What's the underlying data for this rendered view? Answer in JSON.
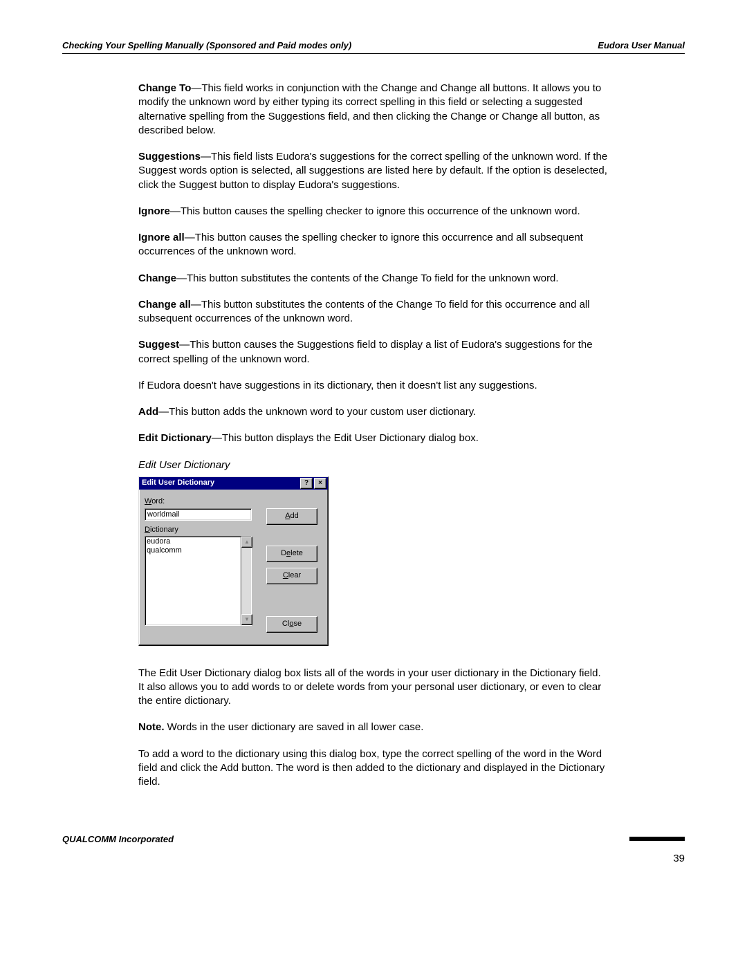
{
  "header": {
    "left": "Checking Your Spelling Manually (Sponsored and Paid modes only)",
    "right": "Eudora User Manual"
  },
  "paras": {
    "p1_term": "Change To",
    "p1_body": "—This field works in conjunction with the Change and Change all buttons. It allows you to modify the unknown word by either typing its correct spelling in this field or selecting a suggested alternative spelling from the Suggestions field, and then clicking the Change or Change all button, as described below.",
    "p2_term": "Suggestions",
    "p2_body": "—This field lists Eudora's suggestions for the correct spelling of the unknown word. If the Suggest words option is selected, all suggestions are listed here by default. If the option is deselected, click the Suggest button to display Eudora's suggestions.",
    "p3_term": "Ignore",
    "p3_body": "—This button causes the spelling checker to ignore this occurrence of the unknown word.",
    "p4_term": "Ignore all",
    "p4_body": "—This button causes the spelling checker to ignore this occurrence and all subsequent occurrences of the unknown word.",
    "p5_term": "Change",
    "p5_body": "—This button substitutes the contents of the Change To field for the unknown word.",
    "p6_term": "Change all",
    "p6_body": "—This button substitutes the contents of the Change To field for this occurrence and all subsequent occurrences of the unknown word.",
    "p7_term": "Suggest",
    "p7_body": "—This button causes the Suggestions field to display a list of Eudora's suggestions for the correct spelling of the unknown word.",
    "p8": "If Eudora doesn't have suggestions in its dictionary, then it doesn't list any suggestions.",
    "p9_term": "Add",
    "p9_body": "—This button adds the unknown word to your custom user dictionary.",
    "p10_term": "Edit Dictionary",
    "p10_body": "—This button displays the Edit User Dictionary dialog box.",
    "caption": "Edit User Dictionary",
    "p11": "The Edit User Dictionary dialog box lists all of the words in your user dictionary in the Dictionary field. It also allows you to add words to or delete words from your personal user dictionary, or even to clear the entire dictionary.",
    "p12_term": "Note.",
    "p12_body": " Words in the user dictionary are saved in all lower case.",
    "p13": "To add a word to the dictionary using this dialog box, type the correct spelling of the word in the Word field and click the Add button. The word is then added to the dictionary and displayed in the Dictionary field."
  },
  "dialog": {
    "title": "Edit User Dictionary",
    "word_label_u": "W",
    "word_label_rest": "ord:",
    "word_value": "worldmail",
    "dict_label_u": "D",
    "dict_label_rest": "ictionary",
    "dict_items": [
      "eudora",
      "qualcomm"
    ],
    "btn_add_u": "A",
    "btn_add_rest": "dd",
    "btn_delete_pre": "D",
    "btn_delete_u": "e",
    "btn_delete_rest": "lete",
    "btn_clear_u": "C",
    "btn_clear_rest": "lear",
    "btn_close_pre": "Cl",
    "btn_close_u": "o",
    "btn_close_rest": "se"
  },
  "footer": {
    "company": "QUALCOMM Incorporated",
    "page": "39"
  }
}
